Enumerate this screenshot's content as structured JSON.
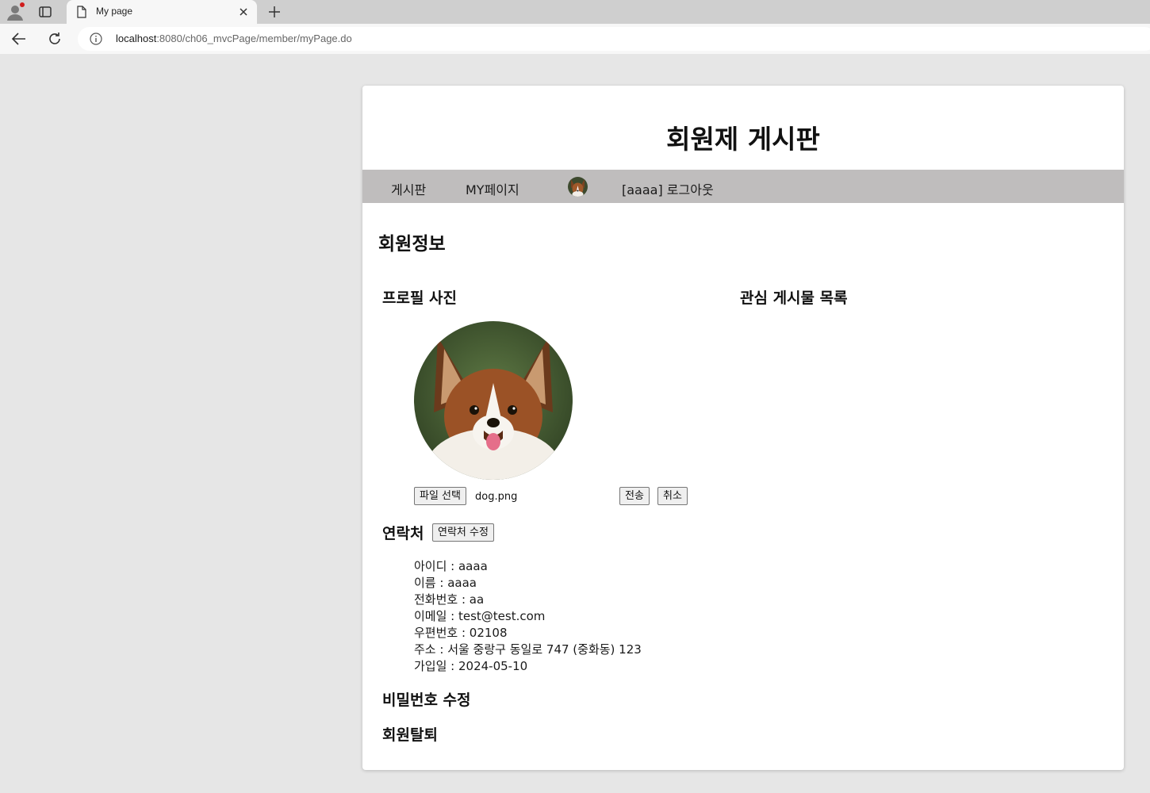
{
  "browser": {
    "tab_title": "My page",
    "url_host": "localhost",
    "url_path": ":8080/ch06_mvcPage/member/myPage.do"
  },
  "site": {
    "title": "회원제 게시판"
  },
  "nav": {
    "board": "게시판",
    "mypage": "MY페이지",
    "user_logout": "[aaaa] 로그아웃"
  },
  "page": {
    "heading": "회원정보"
  },
  "profile": {
    "heading": "프로필 사진",
    "file_button": "파일 선택",
    "file_name": "dog.png",
    "submit_button": "전송",
    "cancel_button": "취소"
  },
  "favorites": {
    "heading": "관심 게시물 목록"
  },
  "contact": {
    "heading": "연락처",
    "edit_button": "연락처 수정",
    "items": [
      "아이디 : aaaa",
      "이름 : aaaa",
      "전화번호 : aa",
      "이메일 : test@test.com",
      "우편번호 : 02108",
      "주소 : 서울 중랑구 동일로 747 (중화동) 123",
      "가입일 : 2024-05-10"
    ]
  },
  "password": {
    "heading": "비밀번호 수정"
  },
  "withdraw": {
    "heading": "회원탈퇴"
  },
  "colors": {
    "page_bg": "#e6e6e6",
    "navbar_bg": "#bfbdbd",
    "card_bg": "#ffffff"
  }
}
